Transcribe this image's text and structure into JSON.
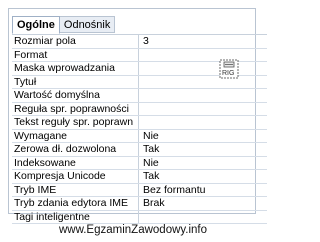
{
  "tabs": [
    {
      "label": "Ogólne",
      "active": true
    },
    {
      "label": "Odnośnik",
      "active": false
    }
  ],
  "properties": [
    {
      "label": "Rozmiar pola",
      "value": "3"
    },
    {
      "label": "Format",
      "value": ""
    },
    {
      "label": "Maska wprowadzania",
      "value": ""
    },
    {
      "label": "Tytuł",
      "value": ""
    },
    {
      "label": "Wartość domyślna",
      "value": ""
    },
    {
      "label": "Reguła spr. poprawności",
      "value": ""
    },
    {
      "label": "Tekst reguły spr. poprawn",
      "value": ""
    },
    {
      "label": "Wymagane",
      "value": "Nie"
    },
    {
      "label": "Zerowa dł. dozwolona",
      "value": "Tak"
    },
    {
      "label": "Indeksowane",
      "value": "Nie"
    },
    {
      "label": "Kompresja Unicode",
      "value": "Tak"
    },
    {
      "label": "Tryb IME",
      "value": "Bez formantu"
    },
    {
      "label": "Tryb zdania edytora IME",
      "value": "Brak"
    },
    {
      "label": "Tagi inteligentne",
      "value": ""
    }
  ],
  "builder_icon": "smart-tag-builder-icon",
  "watermark": "www.EgzaminZawodowy.info"
}
